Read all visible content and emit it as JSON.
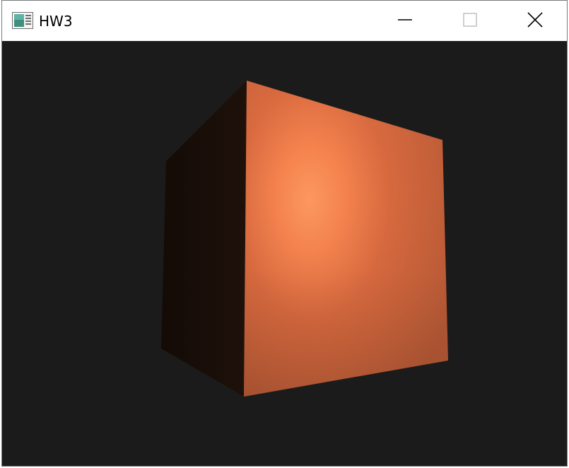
{
  "window": {
    "title": "HW3",
    "controls": {
      "minimize": "minimize-icon",
      "maximize": "maximize-icon",
      "close": "close-icon"
    }
  },
  "scene": {
    "background_color": "#1b1b1b",
    "cube_color": "#d46a3e",
    "cube_highlight_color": "#ff9a62",
    "cube_shadow_face_color": "#1a0e08"
  }
}
